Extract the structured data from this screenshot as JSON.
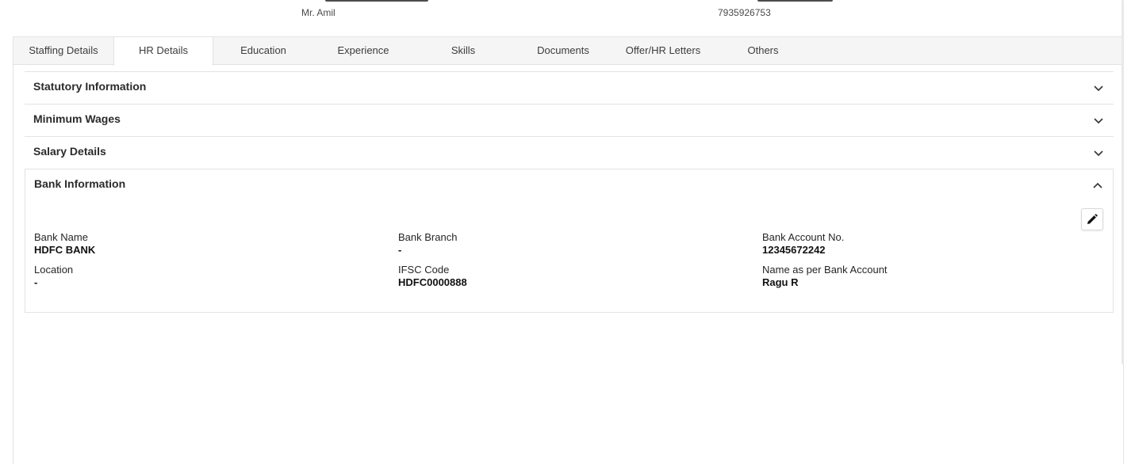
{
  "header": {
    "reporting_manager_value": "Mr. Amil",
    "mobile_value": "7935926753"
  },
  "tabs": [
    {
      "label": "Staffing Details",
      "active": false
    },
    {
      "label": "HR Details",
      "active": true
    },
    {
      "label": "Education",
      "active": false
    },
    {
      "label": "Experience",
      "active": false
    },
    {
      "label": "Skills",
      "active": false
    },
    {
      "label": "Documents",
      "active": false
    },
    {
      "label": "Offer/HR Letters",
      "active": false
    },
    {
      "label": "Others",
      "active": false
    }
  ],
  "sections": {
    "statutory": {
      "title": "Statutory Information",
      "expanded": false
    },
    "minimum_wages": {
      "title": "Minimum Wages",
      "expanded": false
    },
    "salary": {
      "title": "Salary Details",
      "expanded": false
    },
    "bank": {
      "title": "Bank Information",
      "expanded": true,
      "fields": {
        "bank_name": {
          "label": "Bank Name",
          "value": "HDFC BANK"
        },
        "bank_branch": {
          "label": "Bank Branch",
          "value": "-"
        },
        "account_no": {
          "label": "Bank Account No.",
          "value": "12345672242"
        },
        "location": {
          "label": "Location",
          "value": "-"
        },
        "ifsc": {
          "label": "IFSC Code",
          "value": "HDFC0000888"
        },
        "name_as_per_bank": {
          "label": "Name as per Bank Account",
          "value": "Ragu R"
        }
      }
    }
  },
  "icons": {
    "chevron_down": "chevron-down-icon",
    "chevron_up": "chevron-up-icon",
    "edit": "pencil-icon"
  }
}
